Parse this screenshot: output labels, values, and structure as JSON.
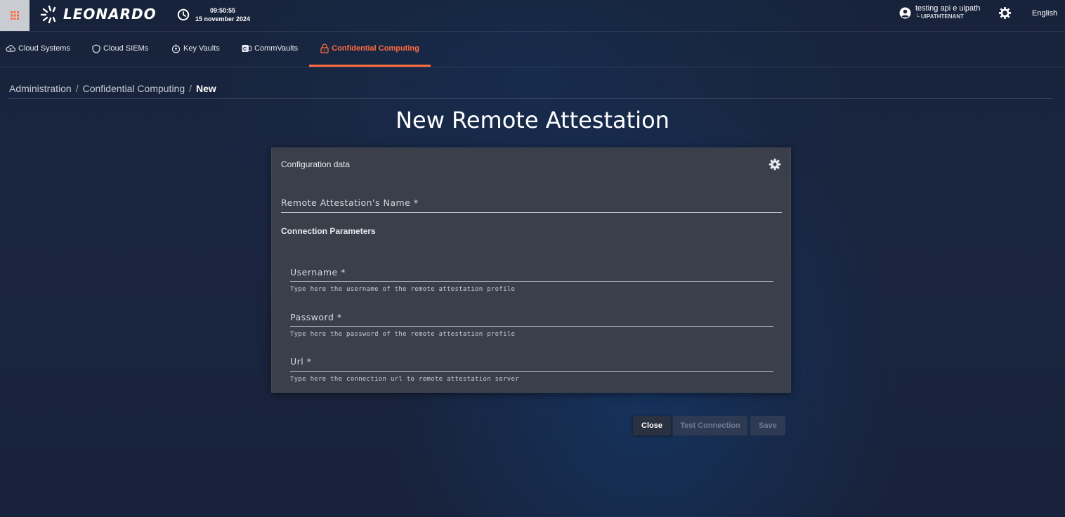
{
  "header": {
    "brand": "LEONARDO",
    "time": "09:50:55",
    "date": "15 november 2024",
    "user_name": "testing api e uipath",
    "user_tenant": "└ UIPATHTENANT",
    "language": "English",
    "icons": {
      "apps": "grid-icon",
      "clock": "clock-icon",
      "user": "user-circle-icon",
      "settings": "settings-icon"
    }
  },
  "nav": {
    "tabs": [
      {
        "label": "Cloud Systems",
        "icon": "cloud-icon"
      },
      {
        "label": "Cloud SIEMs",
        "icon": "shield-icon"
      },
      {
        "label": "Key Vaults",
        "icon": "key-vault-icon"
      },
      {
        "label": "CommVaults",
        "icon": "commvault-icon"
      },
      {
        "label": "Confidential Computing",
        "icon": "lock-icon",
        "active": true
      }
    ]
  },
  "breadcrumb": {
    "items": [
      "Administration",
      "Confidential Computing",
      "New"
    ],
    "separator": "/"
  },
  "page_title": "New Remote Attestation",
  "card": {
    "header": "Configuration data",
    "name_field": {
      "label": "Remote Attestation's Name *",
      "value": ""
    },
    "section_title": "Connection Parameters",
    "username": {
      "label": "Username *",
      "hint": "Type here the username of the remote attestation profile",
      "value": ""
    },
    "password": {
      "label": "Password *",
      "hint": "Type here the password of the remote attestation profile",
      "value": ""
    },
    "url": {
      "label": "Url *",
      "hint": "Type here the connection url to remote attestation server",
      "value": ""
    }
  },
  "actions": {
    "close": "Close",
    "test_connection": "Test Connection",
    "save": "Save"
  },
  "colors": {
    "accent": "#ff6b3d",
    "card_bg": "#3a3f4a",
    "disabled_text": "#6f7c93"
  }
}
